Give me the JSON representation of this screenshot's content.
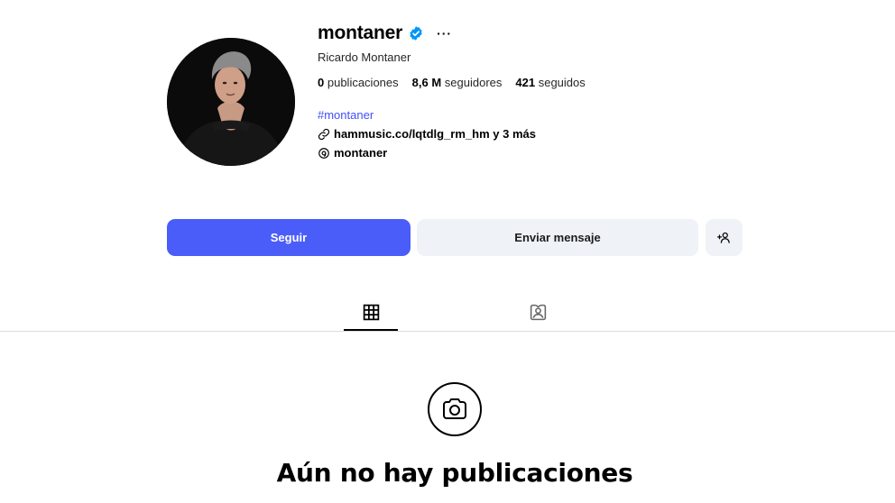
{
  "profile": {
    "username": "montaner",
    "full_name": "Ricardo Montaner",
    "verified": true,
    "more_icon": "more-horizontal-icon",
    "stats": {
      "posts_count": "0",
      "posts_label": "publicaciones",
      "followers_count": "8,6 M",
      "followers_label": "seguidores",
      "following_count": "421",
      "following_label": "seguidos"
    },
    "hashtag": "#montaner",
    "link_text": "hammusic.co/lqtdlg_rm_hm y 3 más",
    "threads_handle": "montaner"
  },
  "actions": {
    "follow_label": "Seguir",
    "message_label": "Enviar mensaje",
    "suggest_icon": "add-person-icon"
  },
  "tabs": [
    {
      "icon": "grid-icon",
      "active": true
    },
    {
      "icon": "tagged-person-icon",
      "active": false
    }
  ],
  "empty_state": {
    "icon": "camera-icon",
    "title": "Aún no hay publicaciones"
  },
  "colors": {
    "accent": "#4a5df9",
    "hashtag": "#4150f7",
    "verified": "#0095f6",
    "secondary_button": "#eff2f6",
    "divider": "#dbdbdb"
  }
}
